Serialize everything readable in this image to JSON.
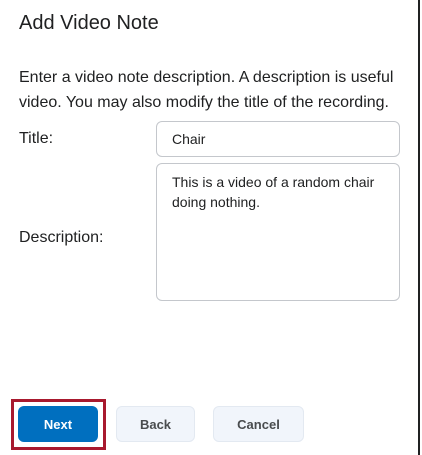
{
  "dialog": {
    "title": "Add Video Note",
    "instructions_line1": "Enter a video note description. A description is useful",
    "instructions_line2": "video. You may also modify the title of the recording."
  },
  "form": {
    "title_label": "Title:",
    "title_value": "Chair",
    "description_label": "Description:",
    "description_value": "This is a video of a random chair doing nothing."
  },
  "buttons": {
    "next_label": "Next",
    "back_label": "Back",
    "cancel_label": "Cancel"
  },
  "colors": {
    "primary_button": "#006fbf",
    "highlight_box": "#a8192e"
  }
}
